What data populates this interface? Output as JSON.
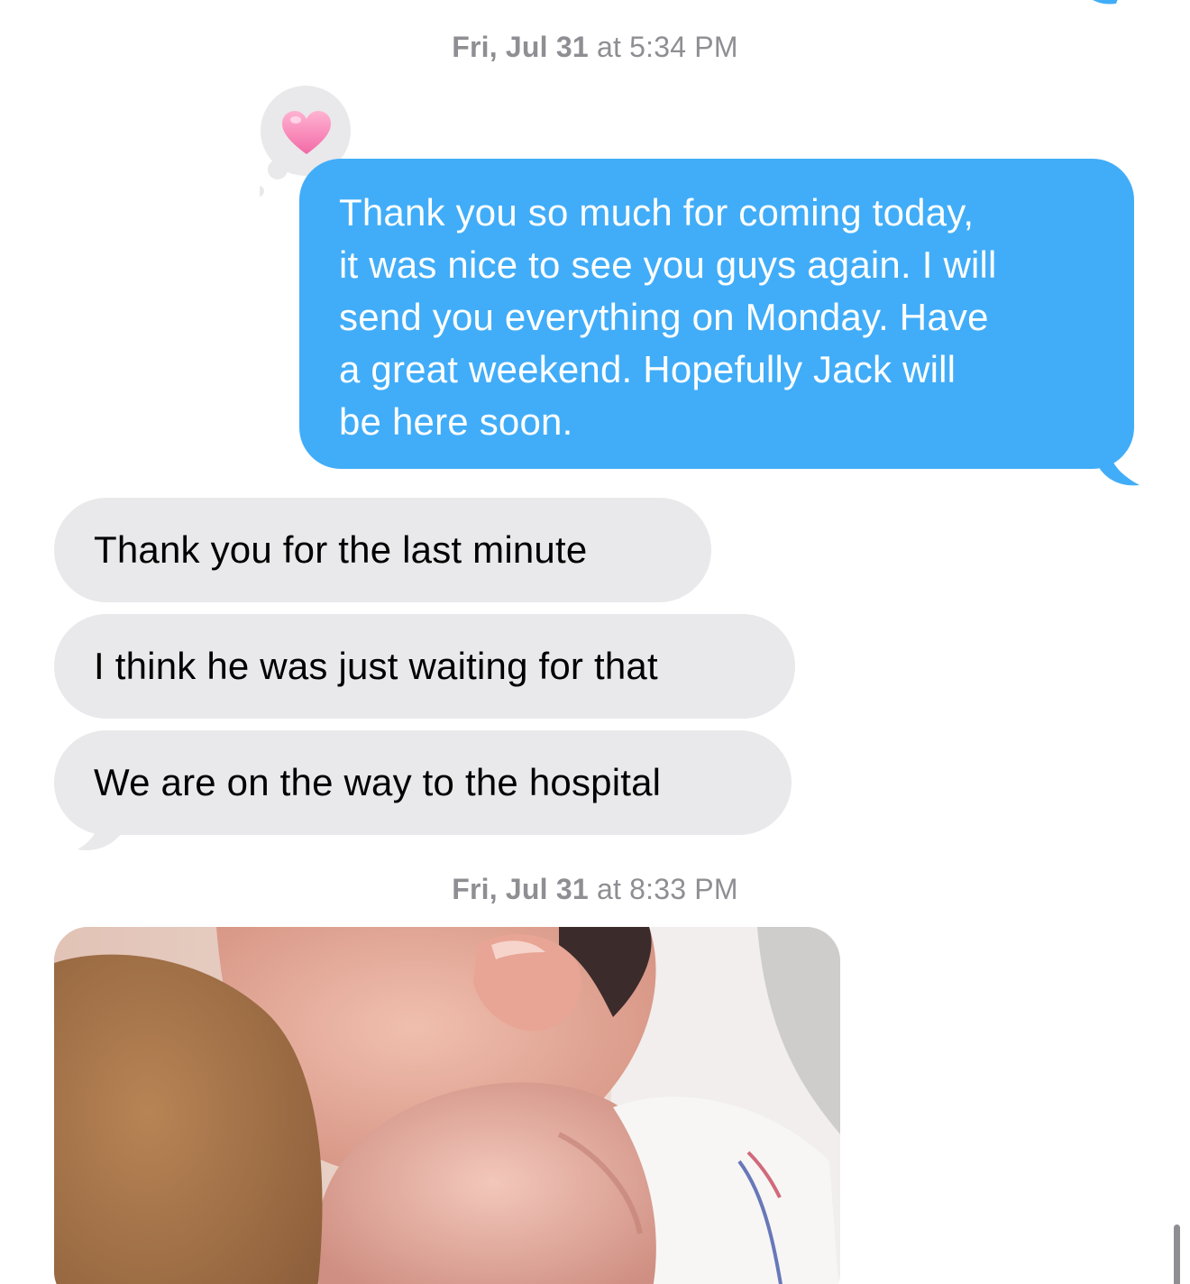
{
  "conversation": {
    "timestamps": [
      {
        "day": "Fri, Jul 31",
        "at": "at",
        "time": "5:34 PM"
      },
      {
        "day": "Fri, Jul 31",
        "at": "at",
        "time": "8:33 PM"
      }
    ],
    "sent_message": {
      "lines": [
        "Thank you so much for coming today,",
        "it was nice to see you guys again. I will",
        "send you everything on Monday. Have",
        "a great weekend. Hopefully Jack will",
        "be here soon."
      ],
      "reaction": "heart-icon"
    },
    "received_messages": [
      "Thank you for the last minute",
      "I think he was just waiting for that",
      "We are on the way to the hospital"
    ],
    "photo": {
      "subject": "newborn-photo"
    }
  },
  "colors": {
    "sent_bubble": "#41adf8",
    "received_bubble": "#e9e9eb",
    "timestamp_text": "#8e8e93",
    "reaction_heart": "#f98ab8",
    "background": "#ffffff"
  }
}
